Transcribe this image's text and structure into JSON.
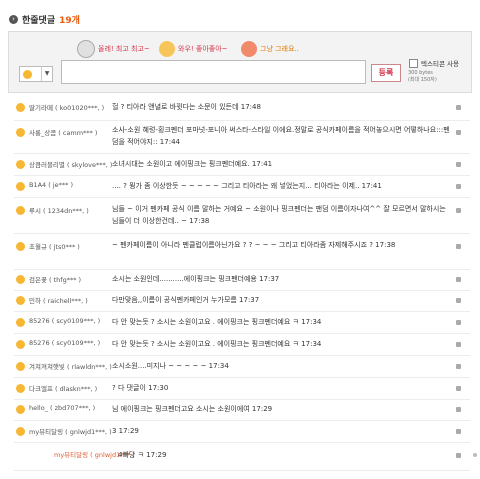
{
  "header": {
    "title": "한줄댓글",
    "count": "19개"
  },
  "quick": [
    {
      "label": "올레! 최고 최고~"
    },
    {
      "label": "와우! 좋아좋아~"
    },
    {
      "label": "그냥 그래요.."
    }
  ],
  "form": {
    "register": "등록",
    "textcon": "텍스티콘 사용",
    "bytes": "300 bytes",
    "bytes_note": "(최대 150자)"
  },
  "comments": [
    {
      "nick": "딸기라떼 ( ko01020***, )",
      "text": "헐 ?  티아라 앤녈로 바뀟다는 소문이 있든데 17:48"
    },
    {
      "nick": "사롱_상콤 ( camm*** )",
      "text": "소사-소원 혜렁-횡크펜더 포마넛-포니아 써스타-스타일 이에요.정말로 공식카페이름을 적어놓으시면 어떻하나요:::펜덤을 적어야지:: 17:44"
    },
    {
      "nick": "상큼러블리별 ( skylove***, )",
      "text": "소녀시대는 소원이고 에이핑크는 핑크펜더예요. 17:41"
    },
    {
      "nick": "B1A4 ( je*** )",
      "text": "....  ? 뭥가 좀 이상한듯  ~ ~ ~ ~ ~  그리고 티아라는 왜 넣었는지... 티아라는 이제.. 17:41"
    },
    {
      "nick": "루시 ( 1234dn***, )",
      "text": "님들 ~ 이거 펜카페 공식 이름 말하는 거예요 ~ 소원이나 핑크펜더는 팬덤 이름이자나여^^ 잘 모르면서 말하시는 님들이 더 이상한건데.. ~ 17:38"
    },
    {
      "nick": "초월규 ( jts0*** )",
      "text": "~ 펜카페이름이 아니라 펜클럽이름아닌가요 ? ? ~ ~ ~ 그리고 티아라좀 자제해주시죠 ? 17:38"
    },
    {
      "nick": "검은꽃 ( thfg*** )",
      "text": "소시는 소원인데...........에이핑크는 핑크펜더예용 17:37"
    },
    {
      "nick": "민하 ( raichell***, )",
      "text": "다만맞음,,이름이 공식펜카페인거 누가모름 17:37"
    },
    {
      "nick": "85276 ( scy0109***, )",
      "text": "다 안 맞는듯 ? 소시는 소원이고요 . 에이핑크는 핑크펜더예요 ㅋ 17:34"
    },
    {
      "nick": "85276 ( scy0109***, )",
      "text": "다 안 맞는듯 ? 소시는 소원이고요 . 에이핑크는 핑크펜더예요 ㅋ 17:34"
    },
    {
      "nick": "겨쳐져쳐햇빛 ( rlawldn***, )",
      "text": "소시소원....미지나 ~ ~ ~ ~ ~ 17:34"
    },
    {
      "nick": "다크엘프 ( dlaskn***, )",
      "text": "? 다 댓글이 17:30"
    },
    {
      "nick": "hello_ ( zbd707***, )",
      "text": "님 에이핑크는 핑크펜더고요 소시는 소원이에여 17:29"
    },
    {
      "nick": "my뷰티달링 ( gnlwjd1***, )",
      "text": "3 17:29"
    },
    {
      "nick": "my뷰티달링 ( gnlwjd1*** )",
      "text": "4빠당 ㅋ 17:29",
      "reply": true
    }
  ],
  "colors": {
    "accent": "#e8590c",
    "brand_red": "#d4364a",
    "emoticon": "#f7b733"
  }
}
